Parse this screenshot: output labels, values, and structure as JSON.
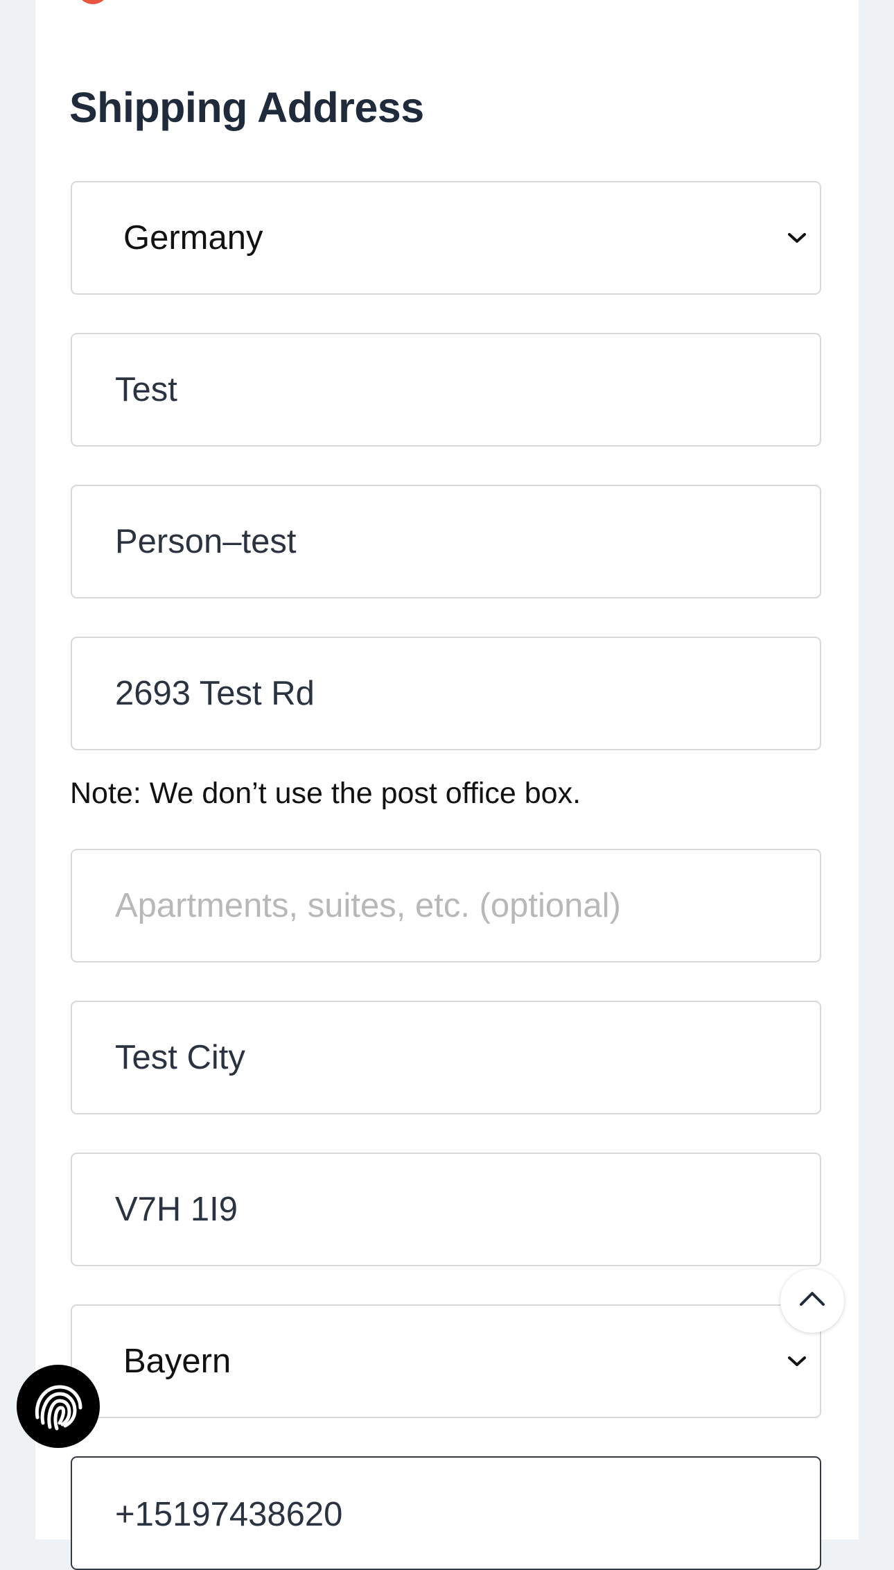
{
  "section_title": "Shipping Address",
  "fields": {
    "country": {
      "value": "Germany",
      "icon": "chevron-down-icon"
    },
    "first_name": {
      "value": "Test"
    },
    "last_name": {
      "value": "Person–test"
    },
    "address": {
      "value": "2693 Test Rd"
    },
    "address_note": "Note: We don’t use the post office box.",
    "apartment": {
      "value": "",
      "placeholder": "Apartments, suites, etc. (optional)"
    },
    "city": {
      "value": "Test City"
    },
    "postal_code": {
      "value": "V7H 1I9"
    },
    "state": {
      "value": "Bayern",
      "icon": "chevron-down-icon"
    },
    "phone": {
      "value": "+15197438620"
    }
  },
  "floating": {
    "scroll_top_icon": "chevron-up-icon",
    "fingerprint_icon": "fingerprint-icon"
  },
  "colors": {
    "page_bg": "#eef2f5",
    "card_bg": "#ffffff",
    "title": "#1f2a3a",
    "accent_dot": "#e8553f",
    "border": "#d8d8d8",
    "active_border": "#333a44",
    "placeholder": "#b8b8b8"
  }
}
